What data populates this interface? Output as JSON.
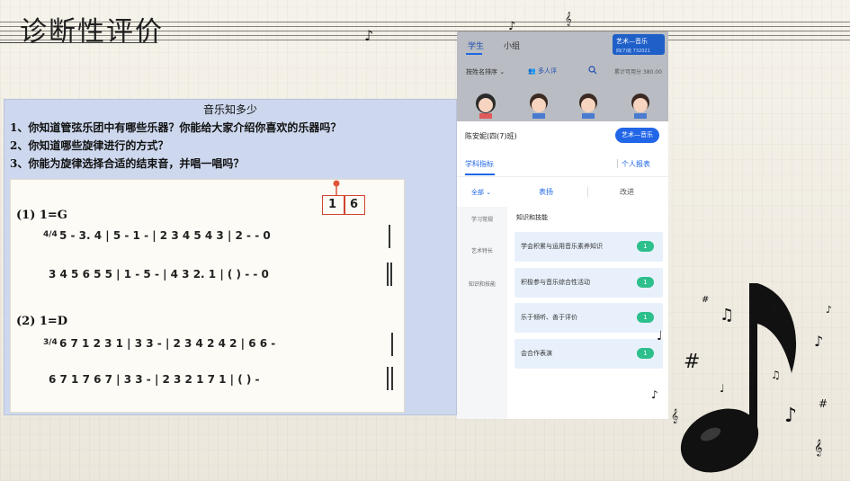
{
  "slide": {
    "title": "诊断性评价"
  },
  "quiz": {
    "heading": "音乐知多少",
    "questions": [
      "1、你知道管弦乐团中有哪些乐器？你能给大家介绍你喜欢的乐器吗？",
      "2、你知道哪些旋律进行的方式？",
      "3、你能为旋律选择合适的结束音，并唱一唱吗？"
    ],
    "score": {
      "part1_key": "(1) 1=G",
      "part1_time": "4/4",
      "part1_line1": "5 - 3. 4 | 5 - 1 - | 2 3 4 5 4 3 | 2 - - 0",
      "part1_line2": "3 4 5 6 5 5 | 1 - 5 - | 4 3 2. 1 | ( ) - - 0",
      "part2_key": "(2) 1=D",
      "part2_time": "3/4",
      "part2_line1": "6 7 1 2 3 1 | 3 3 - | 2 3 4 2 4 2 | 6 6 -",
      "part2_line2": "6 7 1 7 6 7 | 3 3 - | 2 3 2 1 7 1 | ( ) -",
      "ending_options": [
        "1",
        "6"
      ]
    }
  },
  "app": {
    "tabs": [
      "学生",
      "小组"
    ],
    "subject_selector": {
      "label": "艺术—音乐",
      "sub": "四(7)班 732021"
    },
    "sort_label": "按姓名排序",
    "multi_eval_label": "多人评",
    "score_summary": "累计可用分 380.00",
    "student_name": "陈安妮(四(7)班)",
    "subject_button": "艺术—音乐",
    "sheet_tabs": {
      "subject": "学科指标",
      "report": "个人报表"
    },
    "filters": {
      "all": "全部",
      "good": "表扬",
      "improve": "改进"
    },
    "side_nav": [
      "学习常规",
      "艺术特长",
      "知识和技能"
    ],
    "group_title": "知识和技能",
    "indicators": [
      {
        "label": "学会积累与运用音乐素养知识",
        "score": "1"
      },
      {
        "label": "积极参与音乐综合性活动",
        "score": "1"
      },
      {
        "label": "乐于倾听、善于评价",
        "score": "1"
      },
      {
        "label": "会合作表演",
        "score": "1"
      }
    ]
  }
}
